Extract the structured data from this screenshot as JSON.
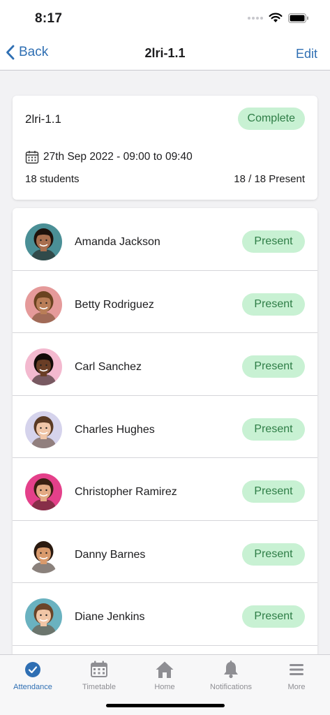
{
  "status_bar": {
    "time": "8:17"
  },
  "nav": {
    "back_label": "Back",
    "title": "2lri-1.1",
    "edit_label": "Edit"
  },
  "session": {
    "name": "2lri-1.1",
    "status": "Complete",
    "date_time": "27th Sep 2022 - 09:00 to 09:40",
    "student_count": "18 students",
    "present_summary": "18 / 18 Present"
  },
  "students": [
    {
      "name": "Amanda Jackson",
      "status": "Present",
      "avatar_bg": "#4a8f96",
      "skin": "#a86f4f",
      "hair": "#1e120c"
    },
    {
      "name": "Betty Rodriguez",
      "status": "Present",
      "avatar_bg": "#e59a9a",
      "skin": "#b97d57",
      "hair": "#6a4320"
    },
    {
      "name": "Carl Sanchez",
      "status": "Present",
      "avatar_bg": "#f3b9cf",
      "skin": "#6a3e26",
      "hair": "#120b08"
    },
    {
      "name": "Charles Hughes",
      "status": "Present",
      "avatar_bg": "#d5d3ec",
      "skin": "#f0c6a8",
      "hair": "#5a3a24"
    },
    {
      "name": "Christopher Ramirez",
      "status": "Present",
      "avatar_bg": "#e4408a",
      "skin": "#e3a983",
      "hair": "#3a1f12"
    },
    {
      "name": "Danny Barnes",
      "status": "Present",
      "avatar_bg": "#ffffff",
      "skin": "#d99a6c",
      "hair": "#2a1a10"
    },
    {
      "name": "Diane Jenkins",
      "status": "Present",
      "avatar_bg": "#6ab2c0",
      "skin": "#f1c6a6",
      "hair": "#6b4428"
    }
  ],
  "tabs": [
    {
      "label": "Attendance",
      "icon": "check-circle-icon",
      "active": true
    },
    {
      "label": "Timetable",
      "icon": "calendar-icon",
      "active": false
    },
    {
      "label": "Home",
      "icon": "house-icon",
      "active": false
    },
    {
      "label": "Notifications",
      "icon": "bell-icon",
      "active": false
    },
    {
      "label": "More",
      "icon": "menu-icon",
      "active": false
    }
  ],
  "colors": {
    "accent": "#2f6fb3",
    "pill_bg": "#c8f1d3",
    "pill_text": "#2e7d46",
    "background": "#f2f2f4"
  }
}
